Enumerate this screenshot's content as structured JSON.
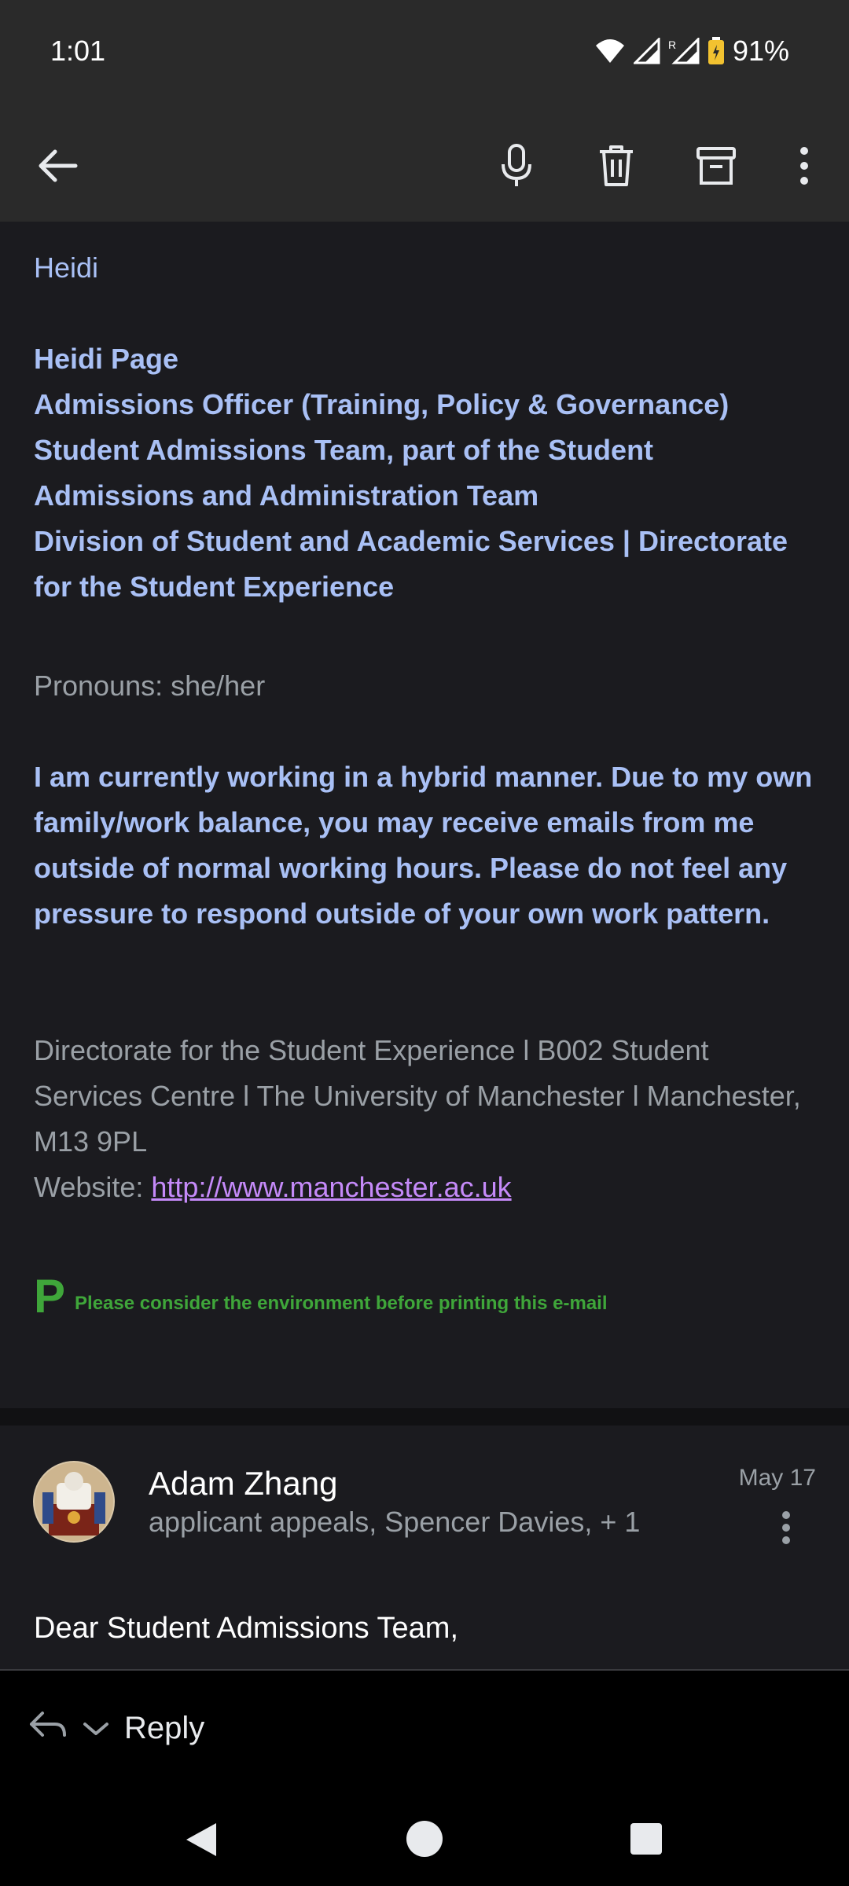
{
  "status_bar": {
    "time": "1:01",
    "battery": "91%",
    "icons": [
      "wifi-icon",
      "cell-signal-icon",
      "roaming-signal-icon",
      "battery-icon"
    ]
  },
  "app_bar": {
    "actions": [
      "back-arrow-icon",
      "microphone-icon",
      "trash-icon",
      "archive-icon",
      "more-vert-icon"
    ]
  },
  "email_body": {
    "greeting_name": "Heidi",
    "signature_lines": [
      "Heidi Page",
      "Admissions Officer (Training, Policy & Governance)",
      "Student Admissions Team, part of the Student Admissions and Administration Team",
      "Division of Student and Academic Services | Directorate for the Student Experience"
    ],
    "pronouns": "Pronouns: she/her",
    "hybrid_notice": "I am currently working in a hybrid manner.  Due to my own family/work balance, you may receive emails from me outside of normal working hours. Please do not feel any pressure to respond outside of your own work pattern.",
    "address": "Directorate for the Student Experience l  B002 Student Services Centre l  The University of Manchester  l  Manchester, M13 9PL",
    "website_label": "Website: ",
    "website_url": "http://www.manchester.ac.uk",
    "env_p": "P",
    "env_message": "Please consider the environment before printing this e-mail"
  },
  "next_message": {
    "sender": "Adam Zhang",
    "recipients": "applicant appeals, Spencer Davies, + 1",
    "date": "May 17",
    "greeting": "Dear Student Admissions Team,"
  },
  "reply_bar": {
    "label": "Reply"
  },
  "colors": {
    "accent_blue": "#a9c0f5",
    "link_purple": "#c58af9",
    "env_green": "#3fa63a"
  }
}
